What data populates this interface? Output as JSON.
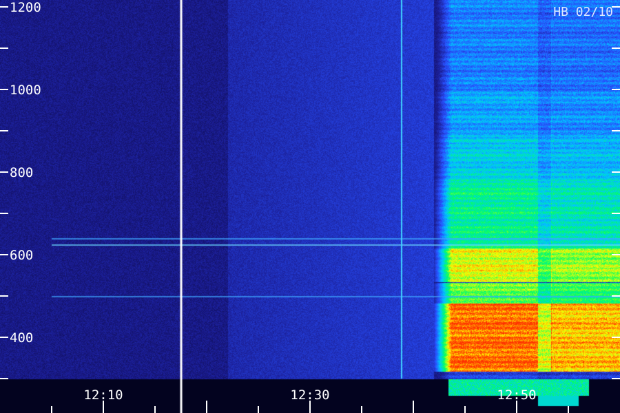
{
  "chart_data": {
    "type": "heatmap",
    "title": "",
    "label_top_right": "HB 02/10",
    "xlabel": "",
    "ylabel": "",
    "x_tick_labels": [
      {
        "label": "12:10",
        "value": 10
      },
      {
        "label": "12:30",
        "value": 30
      },
      {
        "label": "12:50",
        "value": 50
      }
    ],
    "x_range_minutes_after_1200": [
      0,
      60
    ],
    "y_tick_labels": [
      {
        "label": "400",
        "value": 400
      },
      {
        "label": "600",
        "value": 600
      },
      {
        "label": "800",
        "value": 800
      },
      {
        "label": "1000",
        "value": 1000
      },
      {
        "label": "1200",
        "value": 1200
      }
    ],
    "y_range": [
      300,
      1200
    ],
    "grid": false,
    "colormap": [
      "#000010",
      "#1a1a8c",
      "#2850ff",
      "#00c8ff",
      "#00ff64",
      "#ffff00",
      "#ff3000"
    ],
    "intensity_description": {
      "background": "dark blue noise",
      "onset_time": "about 12:42",
      "strongest_band": "300-480",
      "secondary_band": "520-600"
    },
    "data_gap_time": "about 12:17",
    "horizontal_lines_freq": [
      640,
      625,
      500
    ]
  }
}
